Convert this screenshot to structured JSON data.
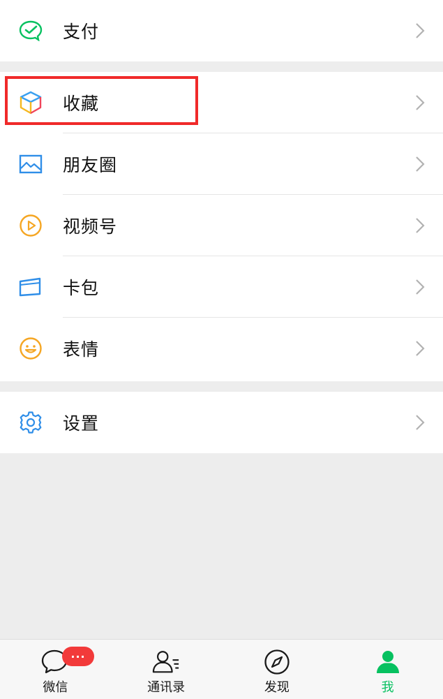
{
  "menu": {
    "group1": [
      {
        "label": "支付",
        "icon": "pay-icon"
      }
    ],
    "group2": [
      {
        "label": "收藏",
        "icon": "favorites-icon"
      },
      {
        "label": "朋友圈",
        "icon": "moments-icon"
      },
      {
        "label": "视频号",
        "icon": "channels-icon"
      },
      {
        "label": "卡包",
        "icon": "card-wallet-icon"
      },
      {
        "label": "表情",
        "icon": "sticker-icon"
      }
    ],
    "group3": [
      {
        "label": "设置",
        "icon": "settings-icon"
      }
    ]
  },
  "tabbar": {
    "items": [
      {
        "label": "微信",
        "icon": "chats-icon",
        "badge": "···"
      },
      {
        "label": "通讯录",
        "icon": "contacts-icon"
      },
      {
        "label": "发现",
        "icon": "discover-icon"
      },
      {
        "label": "我",
        "icon": "me-icon",
        "active": true
      }
    ]
  },
  "colors": {
    "accent": "#07c160",
    "highlight_border": "#f02a2a",
    "badge": "#f23a3a",
    "background": "#ededed"
  }
}
